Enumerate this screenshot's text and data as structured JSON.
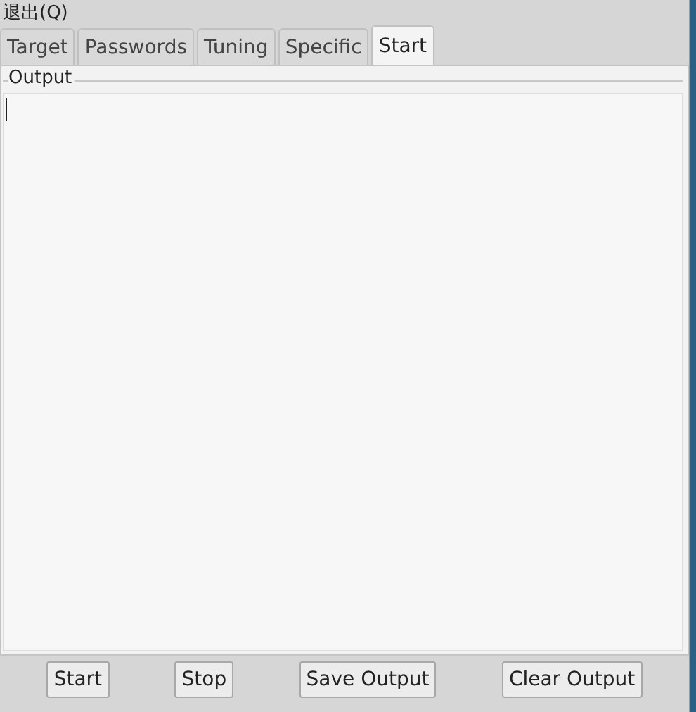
{
  "menu": {
    "items": [
      "退出(Q)"
    ]
  },
  "tabs": [
    {
      "label": "Target",
      "selected": false
    },
    {
      "label": "Passwords",
      "selected": false
    },
    {
      "label": "Tuning",
      "selected": false
    },
    {
      "label": "Specific",
      "selected": false
    },
    {
      "label": "Start",
      "selected": true
    }
  ],
  "output": {
    "title": "Output"
  },
  "buttons": [
    "Start",
    "Stop",
    "Save Output",
    "Clear Output"
  ]
}
